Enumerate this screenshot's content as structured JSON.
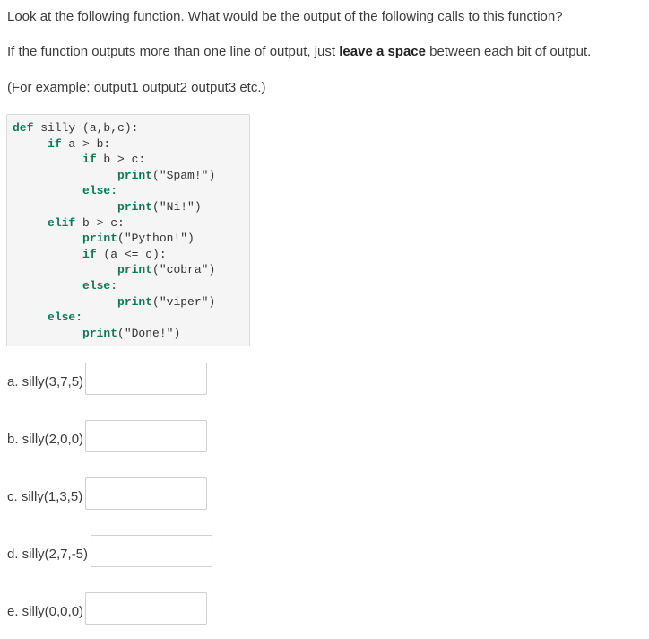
{
  "instructions": {
    "line1": "Look at the following function. What would be the output of the following calls to this function?",
    "line2_pre": "If the function outputs more than one line of output, just ",
    "line2_bold": "leave a space",
    "line2_post": " between each bit of output.",
    "line3": "(For example: output1 output2 output3 etc.)"
  },
  "code": {
    "l1_kw": "def",
    "l1_rest": " silly (a,b,c):",
    "l2_kw": "if",
    "l2_rest": " a > b:",
    "l3_kw": "if",
    "l3_rest": " b > c:",
    "l4_fn": "print",
    "l4_str": "(\"Spam!\")",
    "l5_kw": "else:",
    "l6_fn": "print",
    "l6_str": "(\"Ni!\")",
    "l7_kw": "elif",
    "l7_rest": " b > c:",
    "l8_fn": "print",
    "l8_str": "(\"Python!\")",
    "l9_kw": "if",
    "l9_rest": " (a <= c):",
    "l10_fn": "print",
    "l10_str": "(\"cobra\")",
    "l11_kw": "else:",
    "l12_fn": "print",
    "l12_str": "(\"viper\")",
    "l13_kw": "else:",
    "l14_fn": "print",
    "l14_str": "(\"Done!\")"
  },
  "questions": [
    {
      "label": "a. silly(3,7,5)",
      "value": ""
    },
    {
      "label": "b. silly(2,0,0)",
      "value": ""
    },
    {
      "label": "c. silly(1,3,5)",
      "value": ""
    },
    {
      "label": "d. silly(2,7,-5)",
      "value": ""
    },
    {
      "label": "e. silly(0,0,0)",
      "value": ""
    }
  ]
}
